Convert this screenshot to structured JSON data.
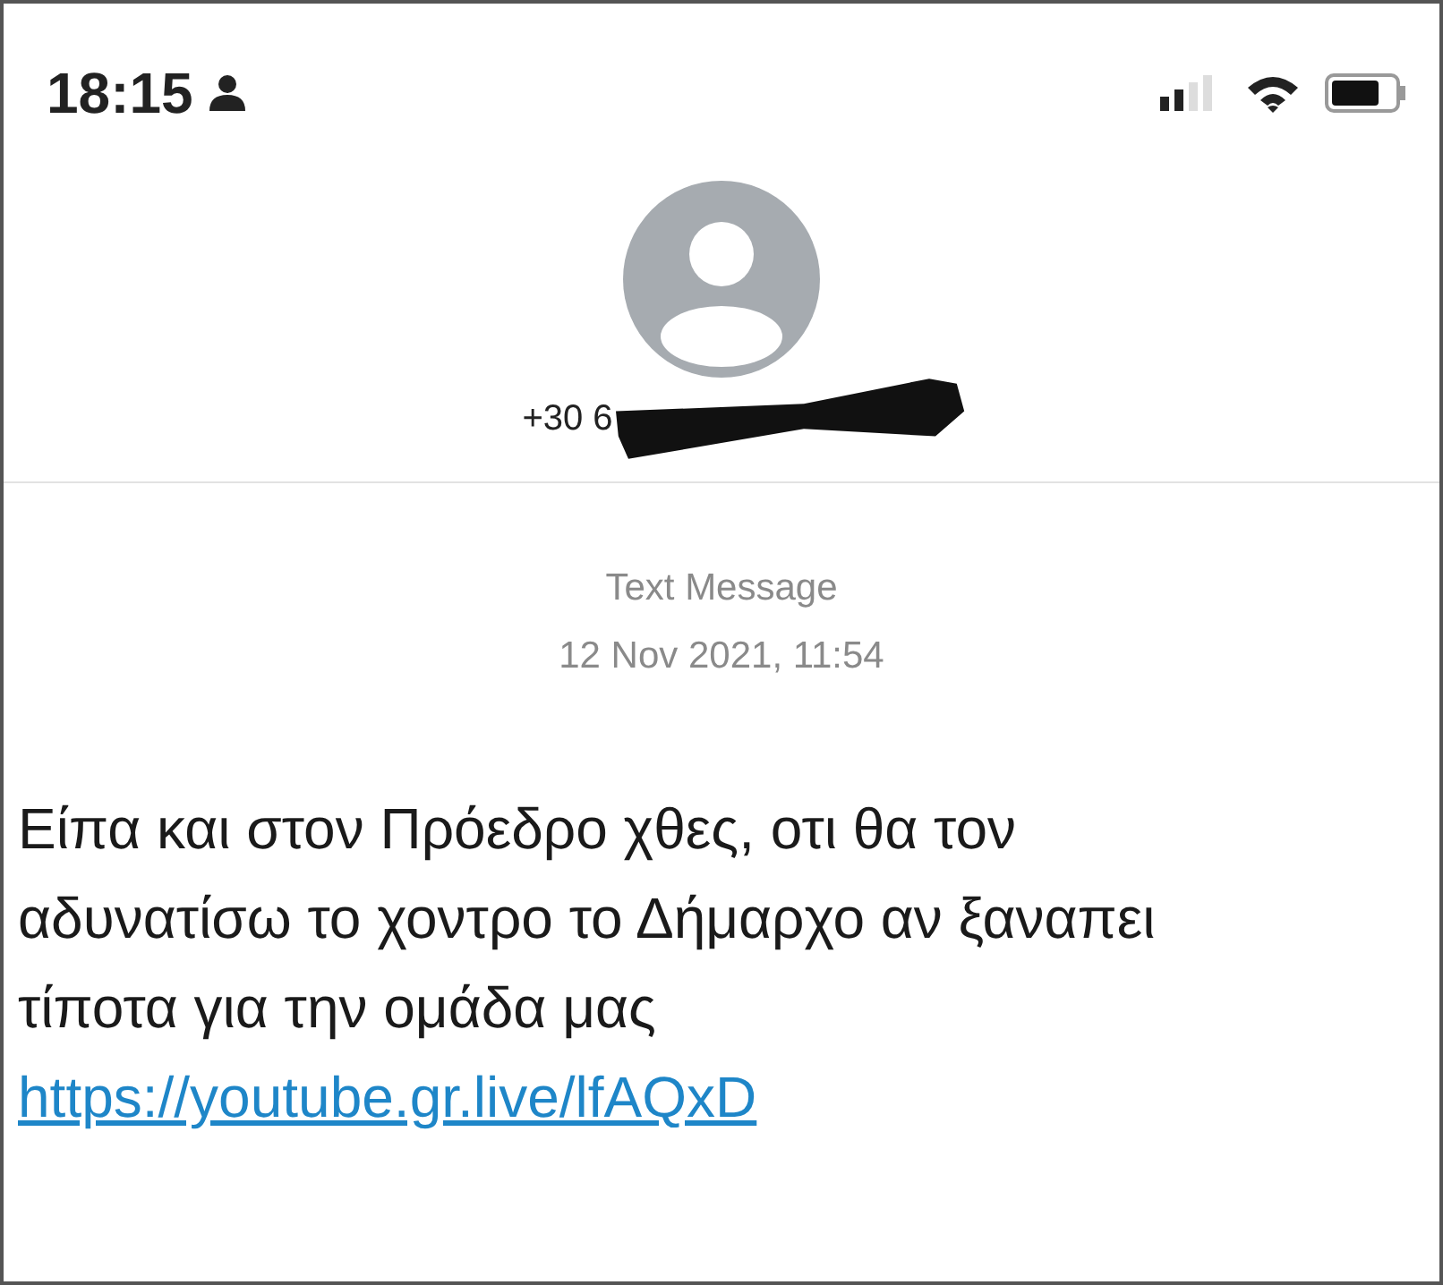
{
  "status_bar": {
    "time": "18:15"
  },
  "contact": {
    "phone": "+30 6"
  },
  "message_header": {
    "service": "Text Message",
    "timestamp": "12 Nov 2021, 11:54"
  },
  "message": {
    "text": "Είπα και στον Πρόεδρο χθες, οτι θα τον αδυνατίσω το χοντρο το Δήμαρχο αν ξαναπει τίποτα για την ομάδα μας",
    "link": "https://youtube.gr.live/lfAQxD"
  }
}
